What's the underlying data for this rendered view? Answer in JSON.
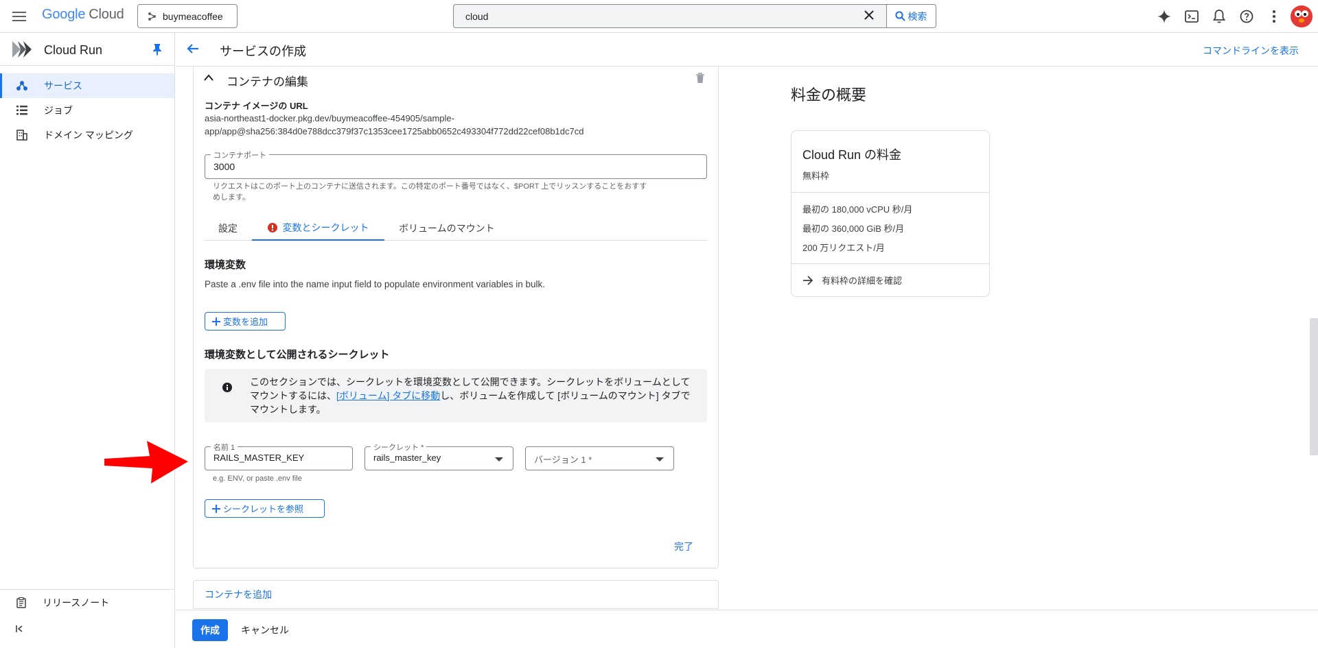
{
  "topbar": {
    "logo_google": "Google",
    "logo_cloud": "Cloud",
    "project": "buymeacoffee",
    "search_value": "cloud",
    "search_button": "検索"
  },
  "nav": {
    "product": "Cloud Run",
    "items": [
      {
        "label": "サービス",
        "icon": "services-icon",
        "active": true
      },
      {
        "label": "ジョブ",
        "icon": "jobs-list-icon",
        "active": false
      },
      {
        "label": "ドメイン マッピング",
        "icon": "domain-icon",
        "active": false
      }
    ],
    "release_notes": "リリースノート"
  },
  "page": {
    "title": "サービスの作成",
    "command_line": "コマンドラインを表示"
  },
  "container": {
    "section_title": "コンテナの編集",
    "image_url_label": "コンテナ イメージの URL",
    "image_url_line1": "asia-northeast1-docker.pkg.dev/buymeacoffee-454905/sample-",
    "image_url_line2": "app/app@sha256:384d0e788dcc379f37c1353cee1725abb0652c493304f772dd22cef08b1dc7cd",
    "port_label": "コンテナポート",
    "port_value": "3000",
    "port_hint_line1": "リクエストはこのポート上のコンテナに送信されます。この特定のポート番号ではなく、$PORT 上でリッスンすることをおすす",
    "port_hint_line2": "めします。",
    "tabs": [
      "設定",
      "変数とシークレット",
      "ボリュームのマウント"
    ],
    "env_title": "環境変数",
    "env_desc": "Paste a .env file into the name input field to populate environment variables in bulk.",
    "add_var": "変数を追加",
    "secrets_title": "環境変数として公開されるシークレット",
    "info_line1": "このセクションでは、シークレットを環境変数として公開できます。シークレットをボリュームとして",
    "info_line2_pre": "マウントするには、",
    "info_link": "[ボリューム] タブに移動",
    "info_line2_post": "し、ボリュームを作成して [ボリュームのマウント] タブで",
    "info_line3": "マウントします。",
    "name_label": "名前 1",
    "name_value": "RAILS_MASTER_KEY",
    "name_hint": "e.g. ENV, or paste .env file",
    "secret_label": "シークレット *",
    "secret_value": "rails_master_key",
    "version_placeholder": "バージョン 1 *",
    "ref_secret": "シークレットを参照",
    "done": "完了",
    "add_container": "コンテナを追加"
  },
  "footer": {
    "create": "作成",
    "cancel": "キャンセル"
  },
  "pricing": {
    "title": "料金の概要",
    "card_title": "Cloud Run の料金",
    "card_sub": "無料枠",
    "lines": [
      "最初の 180,000 vCPU 秒/月",
      "最初の 360,000 GiB 秒/月",
      "200 万リクエスト/月"
    ],
    "link": "有料枠の詳細を確認"
  },
  "colors": {
    "accent": "#1a73e8",
    "error": "#d93025",
    "annotation_arrow": "#ff0000"
  }
}
